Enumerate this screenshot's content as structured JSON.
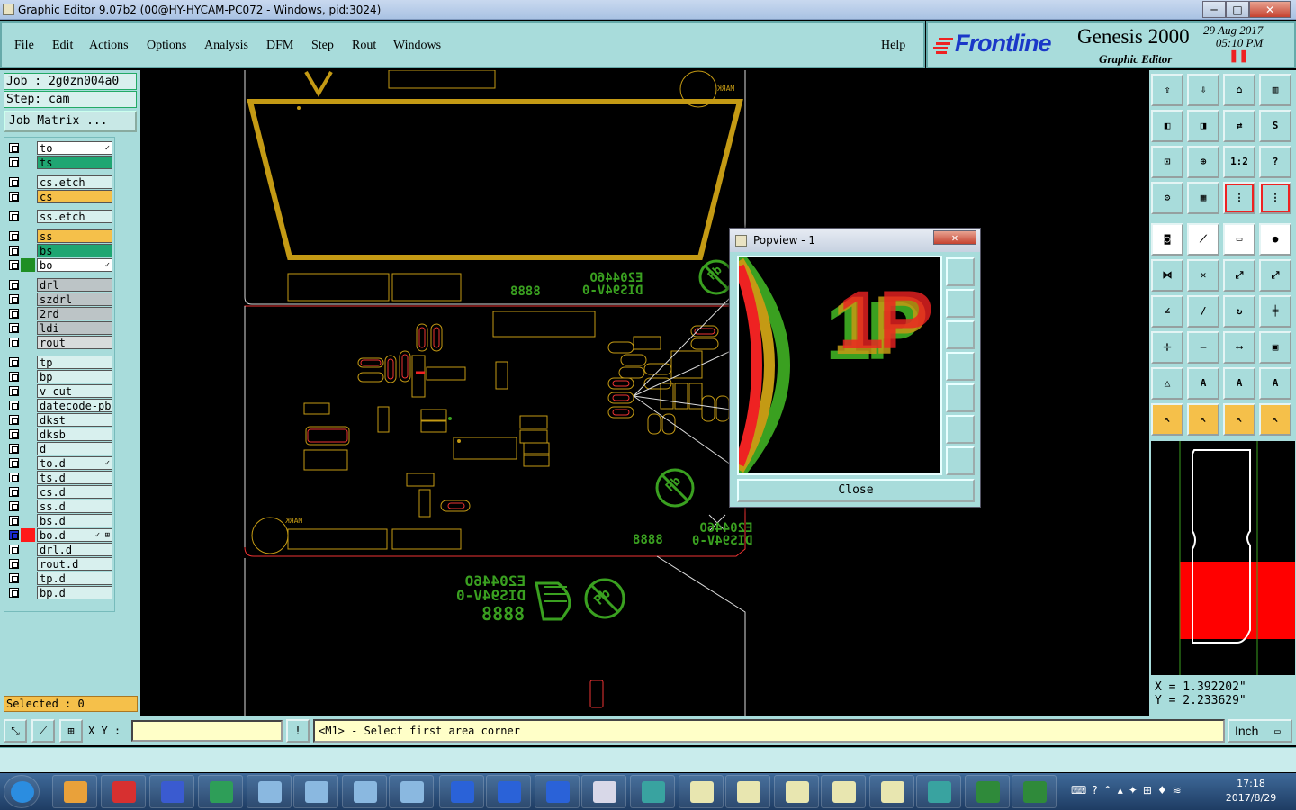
{
  "window": {
    "title": "Graphic Editor 9.07b2 (00@HY-HYCAM-PC072 - Windows, pid:3024)",
    "min": "─",
    "max": "□",
    "close": "✕"
  },
  "menu": [
    "File",
    "Edit",
    "Actions",
    "Options",
    "Analysis",
    "DFM",
    "Step",
    "Rout",
    "Windows"
  ],
  "help": "Help",
  "brand": {
    "logo": "Frontline",
    "product": "Genesis 2000",
    "subtitle": "Graphic Editor",
    "date": "29 Aug 2017",
    "time": "05:10 PM"
  },
  "job": {
    "job": "Job : 2g0zn004a0",
    "step": "Step: cam",
    "matrix": "Job Matrix ..."
  },
  "layers": [
    {
      "name": "to",
      "color": "#ffffff",
      "mark": "✓"
    },
    {
      "name": "ts",
      "color": "#1fa672"
    },
    {
      "name": "cs.etch",
      "color": "#d8f0ee"
    },
    {
      "name": "cs",
      "color": "#f5c04a"
    },
    {
      "name": "ss.etch",
      "color": "#d8f0ee"
    },
    {
      "name": "ss",
      "color": "#f5c04a"
    },
    {
      "name": "bs",
      "color": "#1fa672"
    },
    {
      "name": "bo",
      "color": "#ffffff",
      "swatch": "#1f8f24",
      "mark": "✓"
    },
    {
      "name": "drl",
      "color": "#bcc4c6"
    },
    {
      "name": "szdrl",
      "color": "#bcc4c6"
    },
    {
      "name": "2rd",
      "color": "#bcc4c6"
    },
    {
      "name": "ldi",
      "color": "#bcc4c6"
    },
    {
      "name": "rout",
      "color": "#d8dcdc"
    },
    {
      "name": "tp",
      "color": "#d8f0ee"
    },
    {
      "name": "bp",
      "color": "#d8f0ee"
    },
    {
      "name": "v-cut",
      "color": "#d8f0ee"
    },
    {
      "name": "datecode-pbe",
      "color": "#d8f0ee"
    },
    {
      "name": "dkst",
      "color": "#d8f0ee"
    },
    {
      "name": "dksb",
      "color": "#d8f0ee"
    },
    {
      "name": "d",
      "color": "#d8f0ee"
    },
    {
      "name": "to.d",
      "color": "#d8f0ee",
      "mark": "✓"
    },
    {
      "name": "ts.d",
      "color": "#d8f0ee"
    },
    {
      "name": "cs.d",
      "color": "#d8f0ee"
    },
    {
      "name": "ss.d",
      "color": "#d8f0ee"
    },
    {
      "name": "bs.d",
      "color": "#d8f0ee"
    },
    {
      "name": "bo.d",
      "color": "#d8f0ee",
      "swatch": "#ff1a1a",
      "mark": "✓ ⊞",
      "active": true
    },
    {
      "name": "drl.d",
      "color": "#d8f0ee"
    },
    {
      "name": "rout.d",
      "color": "#d8f0ee"
    },
    {
      "name": "tp.d",
      "color": "#d8f0ee"
    },
    {
      "name": "bp.d",
      "color": "#d8f0ee"
    }
  ],
  "selected": "Selected : 0",
  "coords": {
    "x": "X = 1.392202\"",
    "y": "Y = 2.233629\""
  },
  "command": {
    "xy_label": "X Y :",
    "xy_value": "",
    "warn": "!",
    "prompt": "<M1> - Select first area corner",
    "unit": "Inch"
  },
  "popview": {
    "title": "Popview - 1",
    "close": "Close",
    "preview_text": "1P"
  },
  "board_text": {
    "code1": "E20446O",
    "code2": "DIS94V-0",
    "code3": "8888",
    "mark": "MARK",
    "pb": "Pb"
  },
  "clock": {
    "time": "17:18",
    "date": "2017/8/29"
  },
  "taskbar_icons": [
    "start-orb",
    "shell-icon",
    "g-icon",
    "save-icon",
    "p-icon",
    "win-icon",
    "win-icon",
    "win-icon",
    "win-icon",
    "frontline-icon",
    "frontline-icon",
    "frontline-icon",
    "doc-icon",
    "eye-icon",
    "x-icon",
    "x-icon",
    "x-icon",
    "x-icon",
    "x-icon",
    "eye-icon",
    "excel-icon",
    "excel-icon"
  ]
}
